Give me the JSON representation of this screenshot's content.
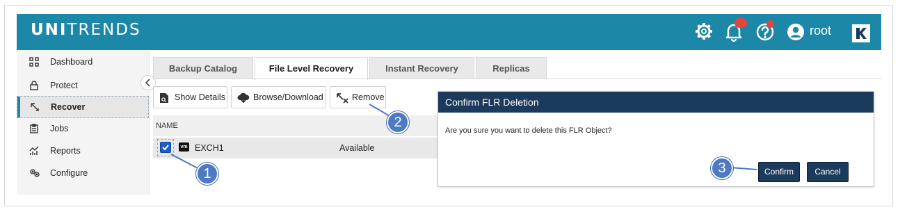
{
  "header": {
    "brand_bold": "UNI",
    "brand_light": "TRENDS",
    "user_name": "root",
    "colors": {
      "topbar": "#1c87a6",
      "dialog_header": "#1c3a5c",
      "callout": "#4e79c3",
      "badge": "#e0463e"
    },
    "icons": [
      "gear-icon",
      "bell-icon",
      "help-icon",
      "user-icon",
      "k-logo-icon"
    ]
  },
  "sidebar": {
    "items": [
      {
        "label": "Dashboard",
        "icon": "dashboard-icon"
      },
      {
        "label": "Protect",
        "icon": "lock-icon"
      },
      {
        "label": "Recover",
        "icon": "recover-icon",
        "active": true
      },
      {
        "label": "Jobs",
        "icon": "clipboard-icon"
      },
      {
        "label": "Reports",
        "icon": "chart-icon"
      },
      {
        "label": "Configure",
        "icon": "gears-icon"
      }
    ]
  },
  "tabs": [
    {
      "label": "Backup Catalog"
    },
    {
      "label": "File Level Recovery",
      "active": true
    },
    {
      "label": "Instant Recovery"
    },
    {
      "label": "Replicas"
    }
  ],
  "toolbar": {
    "show_details": "Show Details",
    "browse_download": "Browse/Download",
    "remove": "Remove"
  },
  "table": {
    "column_name": "NAME",
    "row": {
      "name": "EXCH1",
      "status": "Available",
      "vm_badge": "vm",
      "checked": true
    }
  },
  "dialog": {
    "title": "Confirm FLR Deletion",
    "message": "Are you sure you want to delete this FLR Object?",
    "confirm": "Confirm",
    "cancel": "Cancel"
  },
  "callouts": [
    "1",
    "2",
    "3"
  ]
}
